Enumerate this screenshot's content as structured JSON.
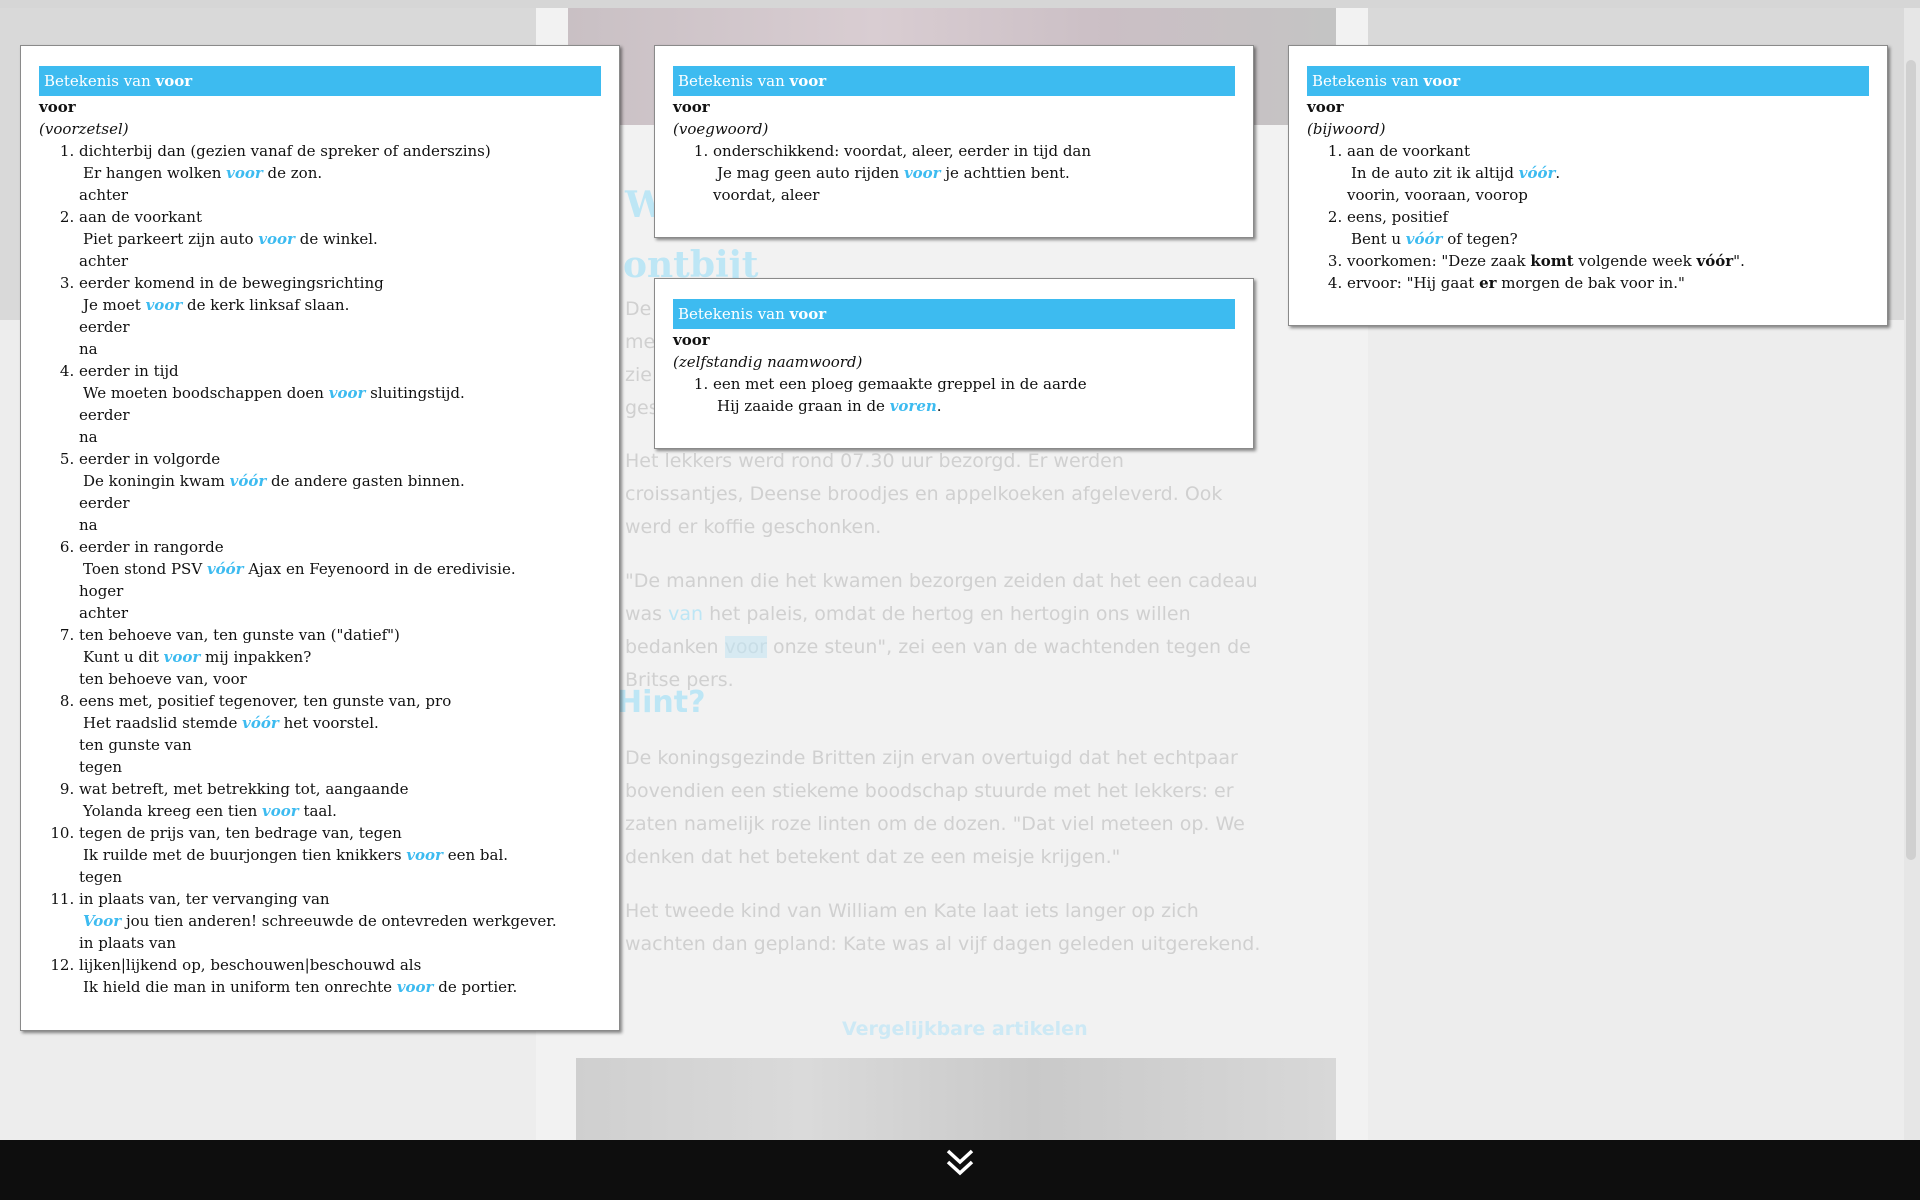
{
  "article": {
    "title_fragment_1": "W",
    "title_fragment_2": "ontbijt",
    "para1": [
      "De",
      "me",
      "zie",
      "ges"
    ],
    "para2": "Het lekkers werd rond 07.30 uur bezorgd. Er werden croissantjes, Deense broodjes en appelkoeken afgeleverd. Ook werd er koffie geschonken.",
    "para3_a": "\"De mannen die het kwamen bezorgen zeiden dat het een cadeau was ",
    "para3_link": "van",
    "para3_b": " het paleis, omdat de hertog en hertogin ons willen bedanken ",
    "para3_hl": "voor",
    "para3_c": " onze steun\", zei een van de wachtenden tegen de Britse pers.",
    "hint": "Hint?",
    "para4": "De koningsgezinde Britten zijn ervan overtuigd dat het echtpaar bovendien een stiekeme boodschap stuurde met het lekkers: er zaten namelijk roze linten om de dozen. \"Dat viel meteen op. We denken dat het betekent dat ze een meisje krijgen.\"",
    "para5": "Het tweede kind van William en Kate laat iets langer op zich wachten dan gepland: Kate was al vijf dagen geleden uitgerekend.",
    "similar": "Vergelijkbare artikelen"
  },
  "popups": {
    "header_prefix": "Betekenis van ",
    "word": "voor",
    "voorzetsel": {
      "pos": "(voorzetsel)",
      "senses": [
        {
          "def": "dichterbij dan (gezien vanaf de spreker of anderszins)",
          "ex_a": "Er hangen wolken ",
          "kw": "voor",
          "ex_b": " de zon.",
          "syn": [
            "achter"
          ]
        },
        {
          "def": "aan de voorkant",
          "ex_a": "Piet parkeert zijn auto ",
          "kw": "voor",
          "ex_b": " de winkel.",
          "syn": [
            "achter"
          ]
        },
        {
          "def": "eerder komend in de bewegingsrichting",
          "ex_a": "Je moet ",
          "kw": "voor",
          "ex_b": " de kerk linksaf slaan.",
          "syn": [
            "eerder",
            "na"
          ]
        },
        {
          "def": "eerder in tijd",
          "ex_a": "We moeten boodschappen doen ",
          "kw": "voor",
          "ex_b": " sluitingstijd.",
          "syn": [
            "eerder",
            "na"
          ]
        },
        {
          "def": "eerder in volgorde",
          "ex_a": "De koningin kwam ",
          "kw": "vóór",
          "ex_b": " de andere gasten binnen.",
          "syn": [
            "eerder",
            "na"
          ]
        },
        {
          "def": "eerder in rangorde",
          "ex_a": "Toen stond PSV ",
          "kw": "vóór",
          "ex_b": " Ajax en Feyenoord in de eredivisie.",
          "syn": [
            "hoger",
            "achter"
          ]
        },
        {
          "def": "ten behoeve van, ten gunste van (\"datief\")",
          "ex_a": "Kunt u dit ",
          "kw": "voor",
          "ex_b": " mij inpakken?",
          "syn": [
            "ten behoeve van, voor"
          ]
        },
        {
          "def": "eens met, positief tegenover, ten gunste van, pro",
          "ex_a": "Het raadslid stemde ",
          "kw": "vóór",
          "ex_b": " het voorstel.",
          "syn": [
            "ten gunste van",
            "tegen"
          ]
        },
        {
          "def": "wat betreft, met betrekking tot, aangaande",
          "ex_a": "Yolanda kreeg een tien ",
          "kw": "voor",
          "ex_b": " taal.",
          "syn": []
        },
        {
          "def": "tegen de prijs van, ten bedrage van, tegen",
          "ex_a": "Ik ruilde met de buurjongen tien knikkers ",
          "kw": "voor",
          "ex_b": " een bal.",
          "syn": [
            "tegen"
          ]
        },
        {
          "def": "in plaats van, ter vervanging van",
          "ex_a": "",
          "kw": "Voor",
          "ex_b": " jou tien anderen! schreeuwde de ontevreden werkgever.",
          "syn": [
            "in plaats van"
          ]
        },
        {
          "def": "lijken|lijkend op, beschouwen|beschouwd als",
          "ex_a": "Ik hield die man in uniform ten onrechte ",
          "kw": "voor",
          "ex_b": " de portier.",
          "syn": []
        }
      ]
    },
    "voegwoord": {
      "pos": "(voegwoord)",
      "senses": [
        {
          "def": "onderschikkend: voordat, aleer, eerder in tijd dan",
          "ex_a": "Je mag geen auto rijden ",
          "kw": "voor",
          "ex_b": " je achttien bent.",
          "syn": [
            "voordat, aleer"
          ]
        }
      ]
    },
    "zelfstandig": {
      "pos": "(zelfstandig naamwoord)",
      "senses": [
        {
          "def": "een met een ploeg gemaakte greppel in de aarde",
          "ex_a": "Hij zaaide graan in de ",
          "kw": "voren",
          "ex_b": ".",
          "syn": []
        }
      ]
    },
    "bijwoord": {
      "pos": "(bijwoord)",
      "s1_def": "aan de voorkant",
      "s1_ex_a": "In de auto zit ik altijd ",
      "s1_kw": "vóór",
      "s1_ex_b": ".",
      "s1_syn": "voorin, vooraan, voorop",
      "s2_def": "eens, positief",
      "s2_ex_a": "Bent u ",
      "s2_kw": "vóór",
      "s2_ex_b": " of tegen?",
      "s3_a": "voorkomen: \"Deze zaak ",
      "s3_b1": "komt",
      "s3_c": " volgende week ",
      "s3_b2": "vóór",
      "s3_d": "\".",
      "s4_a": "ervoor: \"Hij gaat ",
      "s4_b": "er",
      "s4_c": " morgen de bak voor in.\""
    }
  },
  "bottom_bar": {
    "icon": "double-chevron-down-icon"
  }
}
